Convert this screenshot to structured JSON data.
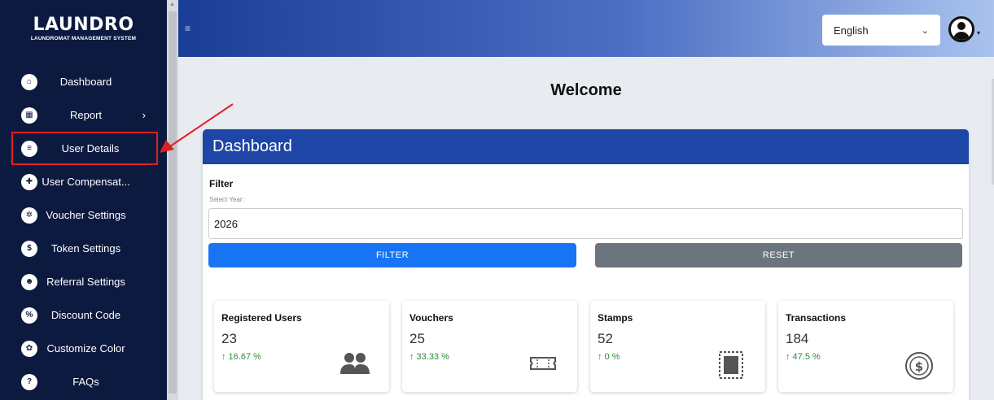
{
  "logo": {
    "title": "LAUNDRO",
    "subtitle": "LAUNDROMAT MANAGEMENT SYSTEM"
  },
  "sidebar": {
    "items": [
      {
        "label": "Dashboard",
        "icon": "home-icon",
        "glyph": "⌂"
      },
      {
        "label": "Report",
        "icon": "report-icon",
        "glyph": "▦"
      },
      {
        "label": "User Details",
        "icon": "user-details-icon",
        "glyph": "≡"
      },
      {
        "label": "User Compensat...",
        "icon": "gift-icon",
        "glyph": "✚"
      },
      {
        "label": "Voucher Settings",
        "icon": "gear-icon",
        "glyph": "✲"
      },
      {
        "label": "Token Settings",
        "icon": "token-icon",
        "glyph": "$"
      },
      {
        "label": "Referral Settings",
        "icon": "users-icon",
        "glyph": "☻"
      },
      {
        "label": "Discount Code",
        "icon": "percent-icon",
        "glyph": "%"
      },
      {
        "label": "Customize Color",
        "icon": "palette-icon",
        "glyph": "✿"
      },
      {
        "label": "FAQs",
        "icon": "question-icon",
        "glyph": "?"
      }
    ],
    "report_chevron": "›"
  },
  "header": {
    "hamburger": "≡",
    "language": "English",
    "language_caret": "⌄",
    "avatar_caret": "▾"
  },
  "main": {
    "welcome": "Welcome",
    "card_title": "Dashboard",
    "filter_label": "Filter",
    "year_label": "Select Year:",
    "year_value": "2026",
    "filter_button": "FILTER",
    "reset_button": "RESET"
  },
  "stats": [
    {
      "title": "Registered Users",
      "value": "23",
      "change": "↑ 16.67 %",
      "icon": "users-icon"
    },
    {
      "title": "Vouchers",
      "value": "25",
      "change": "↑ 33.33 %",
      "icon": "ticket-icon"
    },
    {
      "title": "Stamps",
      "value": "52",
      "change": "↑ 0 %",
      "icon": "stamp-icon"
    },
    {
      "title": "Transactions",
      "value": "184",
      "change": "↑ 47.5 %",
      "icon": "dollar-coin-icon"
    }
  ],
  "colors": {
    "sidebar_bg": "#0d1a40",
    "card_header": "#1e46a6",
    "filter_button": "#1775f5",
    "reset_button": "#6c757d",
    "positive_change": "#2e8b3a",
    "annotation": "#e02020"
  }
}
